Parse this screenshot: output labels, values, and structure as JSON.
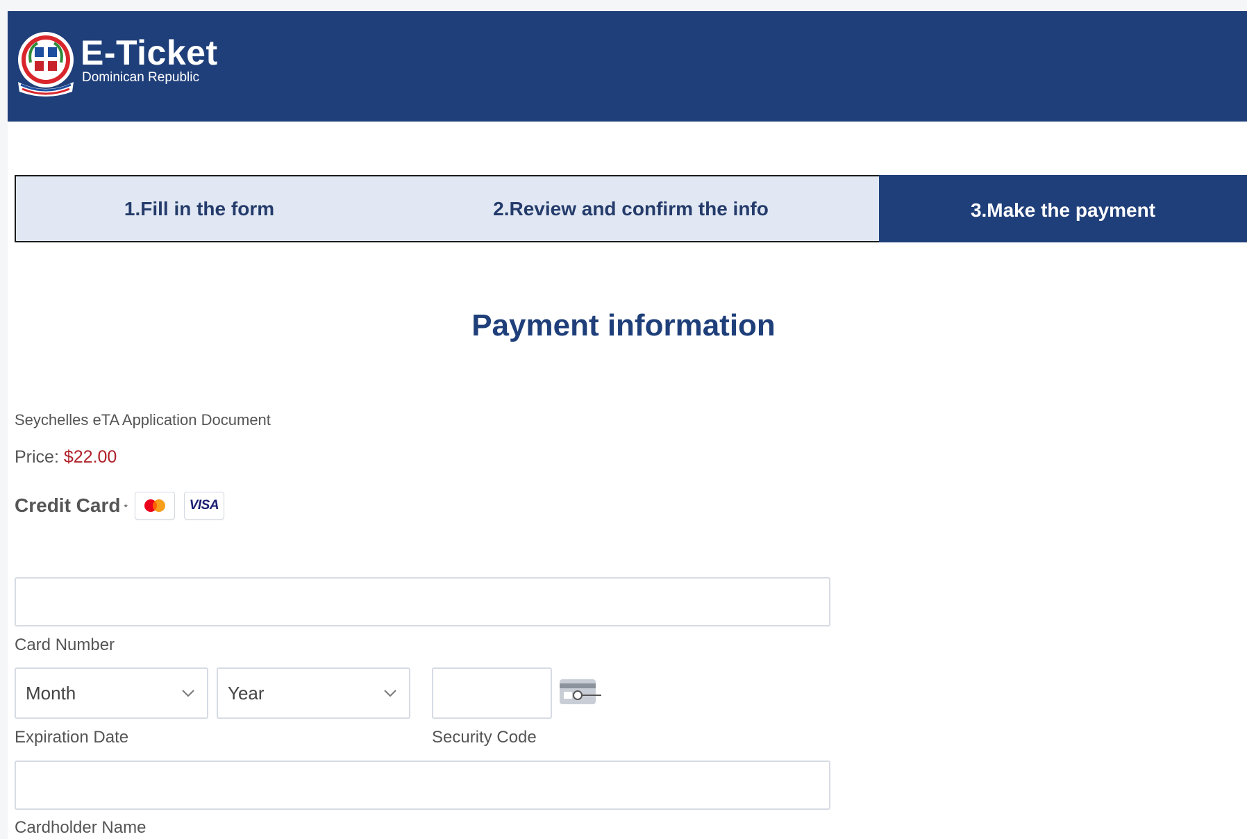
{
  "header": {
    "logo_title": "E-Ticket",
    "logo_subtitle": "Dominican Republic",
    "brand_color": "#1f3f7a"
  },
  "steps": [
    {
      "label": "1.Fill in the form",
      "active": false
    },
    {
      "label": "2.Review and confirm the info",
      "active": false
    },
    {
      "label": "3.Make the payment",
      "active": true
    }
  ],
  "payment": {
    "title": "Payment information",
    "document_name": "Seychelles eTA Application Document",
    "price_label": "Price: ",
    "price_value": "$22.00",
    "credit_card_label": "Credit Card",
    "required_mark": "*",
    "card_brands": [
      "mastercard-icon",
      "visa-icon"
    ],
    "visa_text": "VISA"
  },
  "form": {
    "card_number": {
      "value": "",
      "label": "Card Number"
    },
    "expiration": {
      "label": "Expiration Date",
      "month_selected": "Month",
      "year_selected": "Year"
    },
    "security_code": {
      "value": "",
      "label": "Security Code"
    },
    "cardholder_name": {
      "value": "",
      "label": "Cardholder Name"
    }
  }
}
